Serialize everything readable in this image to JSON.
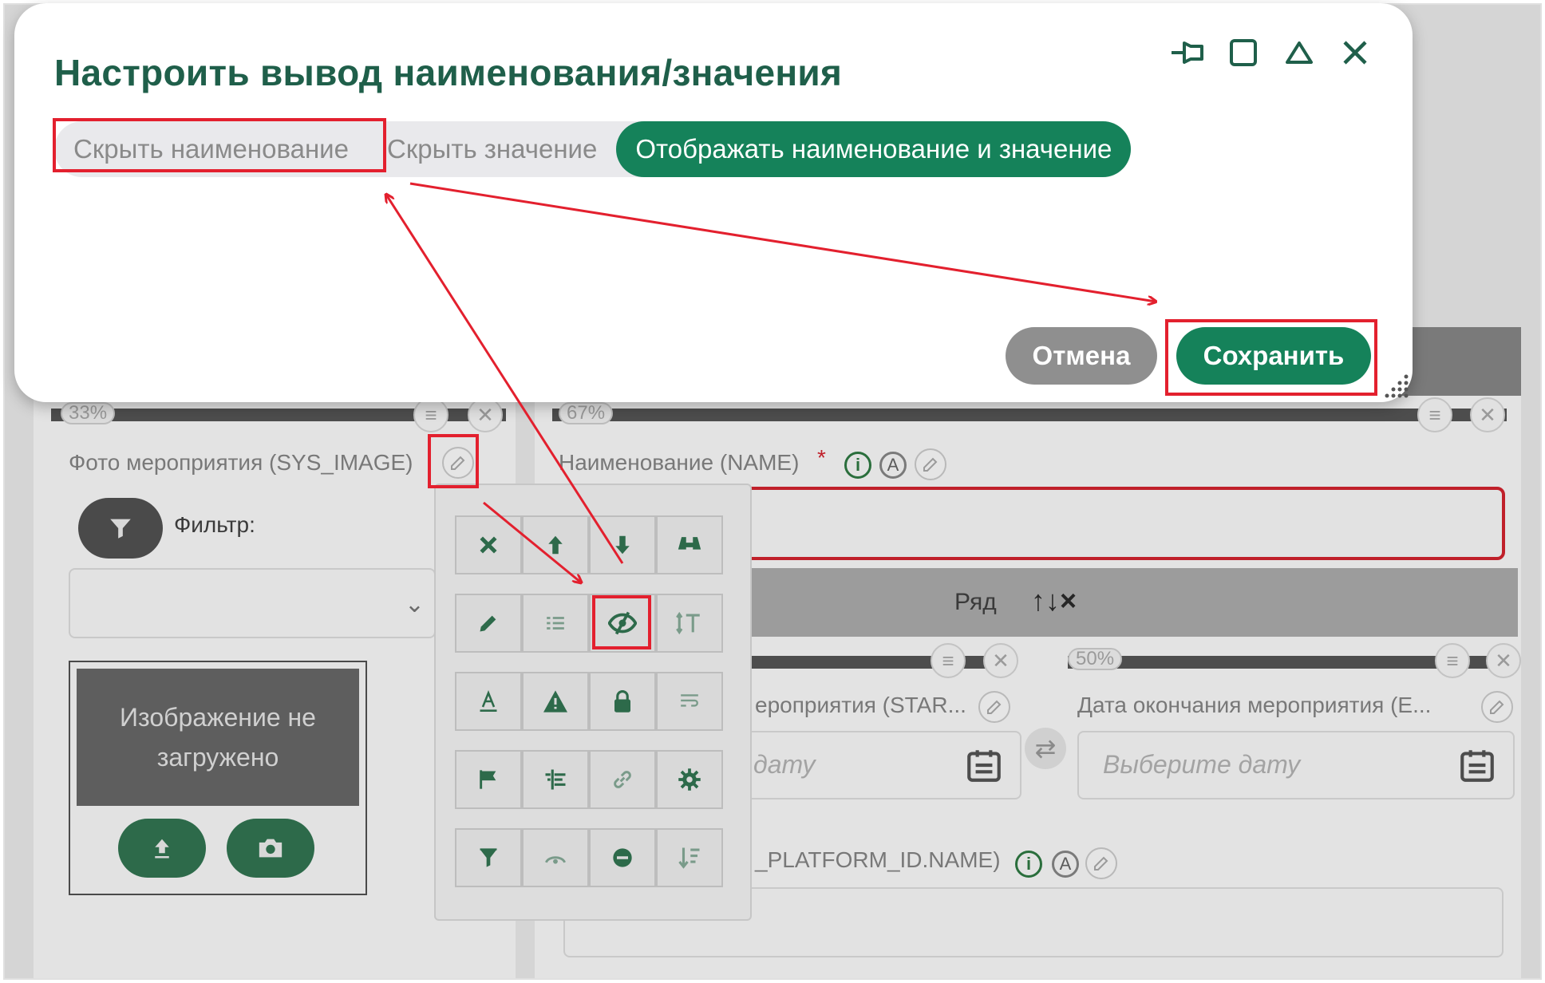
{
  "dialog": {
    "title": "Настроить вывод наименования/значения",
    "options": [
      {
        "label": "Скрыть наименование",
        "selected": false
      },
      {
        "label": "Скрыть значение",
        "selected": false
      },
      {
        "label": "Отображать наименование и значение",
        "selected": true
      }
    ],
    "cancel_label": "Отмена",
    "save_label": "Сохранить",
    "window_controls": [
      "pin-icon",
      "maximize-icon",
      "collapse-icon",
      "close-icon"
    ]
  },
  "background": {
    "left_column": {
      "width_badge": "33%",
      "field_label": "Фото мероприятия (SYS_IMAGE)",
      "filter_label": "Фильтр:",
      "image_placeholder": "Изображение не загружено",
      "buttons": [
        "upload-icon",
        "camera-icon"
      ]
    },
    "right_column": {
      "width_badge": "67%",
      "name_label": "Наименование (NAME)",
      "required_mark": "*",
      "info_icon_text": "i",
      "a_icon_text": "A",
      "row_label": "Ряд",
      "row_controls": "↑↓×",
      "start_label": "ероприятия (STAR...",
      "start_placeholder": "дату",
      "end_badge": "50%",
      "end_label": "Дата окончания мероприятия (E...",
      "end_placeholder": "Выберите дату",
      "platform_label": "_PLATFORM_ID.NAME)"
    },
    "palette_tools": [
      [
        "delete-icon",
        "move-up-icon",
        "move-down-icon",
        "binoculars-icon"
      ],
      [
        "pencil-icon",
        "list-icon",
        "visibility-icon",
        "text-height-icon"
      ],
      [
        "font-color-icon",
        "warning-icon",
        "lock-icon",
        "wrap-icon"
      ],
      [
        "flag-icon",
        "align-icon",
        "link-icon",
        "gear-icon"
      ],
      [
        "filter-icon",
        "eye-arc-icon",
        "minus-circle-icon",
        "sort-icon"
      ]
    ]
  },
  "colors": {
    "accent_green": "#15825a",
    "title_green": "#1f5f4a",
    "cancel_gray": "#8f8f8f",
    "highlight_red": "#e3202e"
  }
}
